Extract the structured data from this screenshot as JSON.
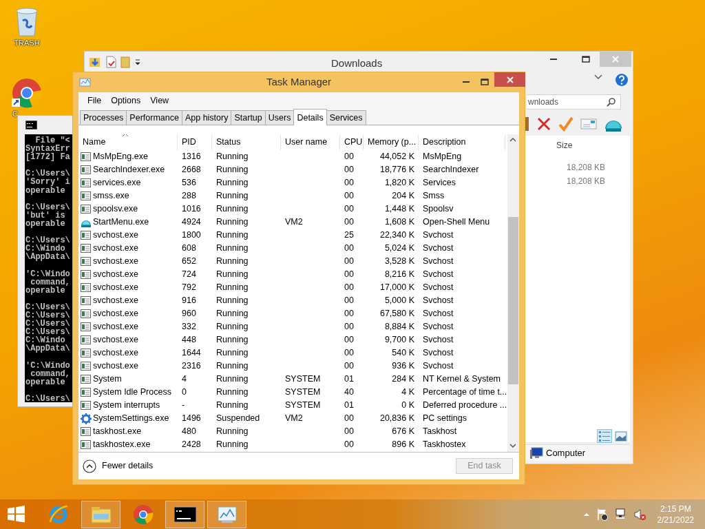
{
  "desktop_icons": [
    {
      "kind": "trash",
      "label": "TRASH"
    },
    {
      "kind": "chrome",
      "label": "C"
    }
  ],
  "explorer": {
    "title": "Downloads",
    "search": {
      "placeholder": "wnloads"
    },
    "columns": [
      "Size"
    ],
    "sizes": [
      "18,208 KB",
      "18,208 KB"
    ],
    "views": [
      {
        "kind": "details",
        "selected": true
      },
      {
        "kind": "tiles",
        "selected": false
      }
    ],
    "status": "Computer"
  },
  "console": {
    "blocks": [
      [
        "  File \"<",
        "SyntaxErr",
        "[1772] Fa"
      ],
      [
        "C:\\Users\\",
        "'Sorry' i",
        "operable"
      ],
      [
        "C:\\Users\\",
        "'but' is",
        "operable"
      ],
      [
        "C:\\Users\\",
        "C:\\Windo",
        "\\AppData\\"
      ],
      [
        "'C:\\Windo",
        " command,",
        "operable"
      ],
      [
        "C:\\Users\\",
        "C:\\Users\\",
        "C:\\Users\\",
        "C:\\Users\\",
        "C:\\Windo",
        "\\AppData\\"
      ],
      [
        "'C:\\Windo",
        " command,",
        "operable"
      ],
      [
        "C:\\Users\\"
      ]
    ]
  },
  "task_manager": {
    "title": "Task Manager",
    "menu": [
      "File",
      "Options",
      "View"
    ],
    "tabs": [
      {
        "label": "Processes",
        "selected": false
      },
      {
        "label": "Performance",
        "selected": false
      },
      {
        "label": "App history",
        "selected": false
      },
      {
        "label": "Startup",
        "selected": false
      },
      {
        "label": "Users",
        "selected": false
      },
      {
        "label": "Details",
        "selected": true
      },
      {
        "label": "Services",
        "selected": false
      }
    ],
    "columns": [
      "Name",
      "PID",
      "Status",
      "User name",
      "CPU",
      "Memory (p...",
      "Description"
    ],
    "rows": [
      {
        "kind": "exe",
        "name": "MsMpEng.exe",
        "pid": "1316",
        "status": "Running",
        "cpu": "00",
        "memory": "44,052 K",
        "description": "MsMpEng"
      },
      {
        "kind": "exe",
        "name": "SearchIndexer.exe",
        "pid": "2668",
        "status": "Running",
        "cpu": "00",
        "memory": "18,776 K",
        "description": "SearchIndexer"
      },
      {
        "kind": "exe",
        "name": "services.exe",
        "pid": "536",
        "status": "Running",
        "cpu": "00",
        "memory": "1,820 K",
        "description": "Services"
      },
      {
        "kind": "exe",
        "name": "smss.exe",
        "pid": "288",
        "status": "Running",
        "cpu": "00",
        "memory": "204 K",
        "description": "Smss"
      },
      {
        "kind": "exe",
        "name": "spoolsv.exe",
        "pid": "1016",
        "status": "Running",
        "cpu": "00",
        "memory": "1,448 K",
        "description": "Spoolsv"
      },
      {
        "kind": "shell",
        "name": "StartMenu.exe",
        "pid": "4924",
        "status": "Running",
        "user": "VM2",
        "cpu": "00",
        "memory": "1,608 K",
        "description": "Open-Shell Menu"
      },
      {
        "kind": "exe",
        "name": "svchost.exe",
        "pid": "1800",
        "status": "Running",
        "cpu": "25",
        "memory": "22,340 K",
        "description": "Svchost"
      },
      {
        "kind": "exe",
        "name": "svchost.exe",
        "pid": "608",
        "status": "Running",
        "cpu": "00",
        "memory": "5,024 K",
        "description": "Svchost"
      },
      {
        "kind": "exe",
        "name": "svchost.exe",
        "pid": "652",
        "status": "Running",
        "cpu": "00",
        "memory": "3,528 K",
        "description": "Svchost"
      },
      {
        "kind": "exe",
        "name": "svchost.exe",
        "pid": "724",
        "status": "Running",
        "cpu": "00",
        "memory": "8,216 K",
        "description": "Svchost"
      },
      {
        "kind": "exe",
        "name": "svchost.exe",
        "pid": "792",
        "status": "Running",
        "cpu": "00",
        "memory": "17,000 K",
        "description": "Svchost"
      },
      {
        "kind": "exe",
        "name": "svchost.exe",
        "pid": "916",
        "status": "Running",
        "cpu": "00",
        "memory": "5,000 K",
        "description": "Svchost"
      },
      {
        "kind": "exe",
        "name": "svchost.exe",
        "pid": "960",
        "status": "Running",
        "cpu": "00",
        "memory": "67,580 K",
        "description": "Svchost"
      },
      {
        "kind": "exe",
        "name": "svchost.exe",
        "pid": "332",
        "status": "Running",
        "cpu": "00",
        "memory": "8,884 K",
        "description": "Svchost"
      },
      {
        "kind": "exe",
        "name": "svchost.exe",
        "pid": "448",
        "status": "Running",
        "cpu": "00",
        "memory": "9,700 K",
        "description": "Svchost"
      },
      {
        "kind": "exe",
        "name": "svchost.exe",
        "pid": "1644",
        "status": "Running",
        "cpu": "00",
        "memory": "540 K",
        "description": "Svchost"
      },
      {
        "kind": "exe",
        "name": "svchost.exe",
        "pid": "2316",
        "status": "Running",
        "cpu": "00",
        "memory": "936 K",
        "description": "Svchost"
      },
      {
        "kind": "exe",
        "name": "System",
        "pid": "4",
        "status": "Running",
        "user": "SYSTEM",
        "cpu": "01",
        "memory": "284 K",
        "description": "NT Kernel & System"
      },
      {
        "kind": "exe",
        "name": "System Idle Process",
        "pid": "0",
        "status": "Running",
        "user": "SYSTEM",
        "cpu": "40",
        "memory": "4 K",
        "description": "Percentage of time t..."
      },
      {
        "kind": "exe",
        "name": "System interrupts",
        "pid": "-",
        "status": "Running",
        "user": "SYSTEM",
        "cpu": "01",
        "memory": "0 K",
        "description": "Deferred procedure ..."
      },
      {
        "kind": "gear",
        "name": "SystemSettings.exe",
        "pid": "1496",
        "status": "Suspended",
        "user": "VM2",
        "cpu": "00",
        "memory": "20,836 K",
        "description": "PC settings"
      },
      {
        "kind": "exe",
        "name": "taskhost.exe",
        "pid": "480",
        "status": "Running",
        "cpu": "00",
        "memory": "676 K",
        "description": "Taskhost"
      },
      {
        "kind": "exe",
        "name": "taskhostex.exe",
        "pid": "2428",
        "status": "Running",
        "cpu": "00",
        "memory": "896 K",
        "description": "Taskhostex"
      }
    ],
    "fewer_details": "Fewer details",
    "end_task": {
      "label": "End task",
      "disabled": true
    }
  },
  "taskbar": {
    "apps": [
      {
        "kind": "start",
        "running": false
      },
      {
        "kind": "ie",
        "running": false
      },
      {
        "kind": "folder",
        "running": true
      },
      {
        "kind": "chrome",
        "running": false
      },
      {
        "kind": "console",
        "running": true
      },
      {
        "kind": "monitor",
        "running": true
      }
    ],
    "tray": [
      {
        "kind": "flag"
      },
      {
        "kind": "network"
      },
      {
        "kind": "volume-muted"
      }
    ],
    "time": "2:15 PM",
    "date": "2/21/2022"
  }
}
